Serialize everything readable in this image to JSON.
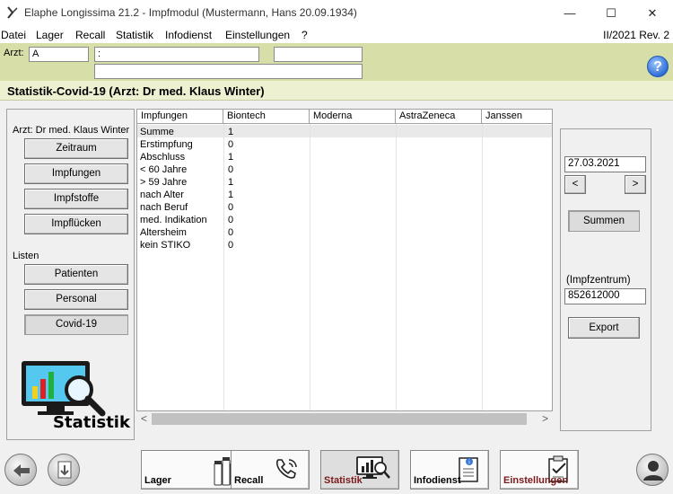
{
  "window": {
    "title": "Elaphe Longissima 21.2 - Impfmodul (Mustermann, Hans  20.09.1934)",
    "minimize": "—",
    "maximize": "☐",
    "close": "✕"
  },
  "menu": {
    "items": [
      "Datei",
      "Lager",
      "Recall",
      "Statistik",
      "Infodienst",
      "Einstellungen",
      "?"
    ],
    "version": "II/2021 Rev. 2"
  },
  "patientbar": {
    "arzt_label": "Arzt:",
    "arzt_value": "A",
    "field2_value": ":",
    "help_label": "?"
  },
  "section": {
    "title": "Statistik-Covid-19 (Arzt: Dr med. Klaus Winter)"
  },
  "left_panel": {
    "arzt": "Arzt: Dr med. Klaus Winter",
    "buttons": [
      "Zeitraum",
      "Impfungen",
      "Impfstoffe",
      "Impflücken"
    ],
    "listen_label": "Listen",
    "list_buttons": [
      "Patienten",
      "Personal",
      "Covid-19"
    ],
    "logo_label": "Statistik"
  },
  "grid": {
    "columns": [
      "Impfungen",
      "Biontech",
      "Moderna",
      "AstraZeneca",
      "Janssen"
    ],
    "rows": [
      {
        "label": "Summe",
        "biontech": "1"
      },
      {
        "label": "Erstimpfung",
        "biontech": "0"
      },
      {
        "label": "Abschluss",
        "biontech": "1"
      },
      {
        "label": "< 60 Jahre",
        "biontech": "0"
      },
      {
        "label": "> 59 Jahre",
        "biontech": "1"
      },
      {
        "label": "nach Alter",
        "biontech": "1"
      },
      {
        "label": "nach Beruf",
        "biontech": "0"
      },
      {
        "label": "med. Indikation",
        "biontech": "0"
      },
      {
        "label": "Altersheim",
        "biontech": "0"
      },
      {
        "label": "kein STIKO",
        "biontech": "0"
      }
    ],
    "scroll_left": "<",
    "scroll_right": ">"
  },
  "right_panel": {
    "date": "27.03.2021",
    "prev": "<",
    "next": ">",
    "summen": "Summen",
    "impfzentrum_label": "(Impfzentrum)",
    "impfzentrum_value": "852612000",
    "export": "Export"
  },
  "bottom": {
    "nav": [
      "Lager",
      "Recall",
      "Statistik",
      "Infodienst",
      "Einstellungen"
    ],
    "active": "Statistik"
  }
}
